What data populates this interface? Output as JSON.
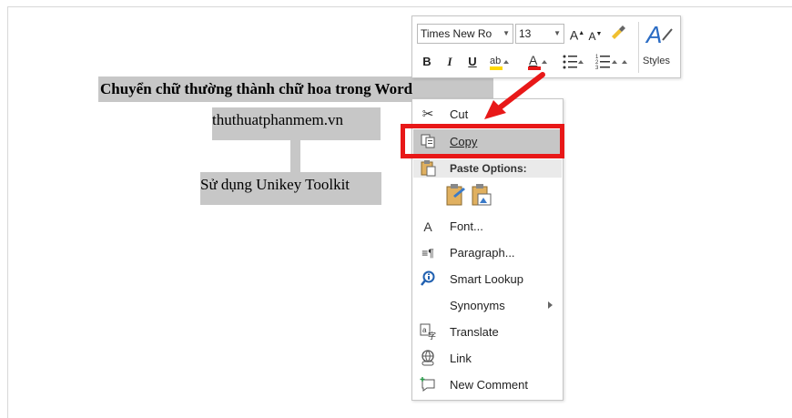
{
  "document": {
    "heading": "Chuyển chữ thường thành chữ hoa trong Word",
    "line1": "thuthuatphanmem.vn",
    "line2": "Sử dụng Unikey Toolkit"
  },
  "mini_toolbar": {
    "font_name": "Times New Ro",
    "font_size": "13",
    "bold": "B",
    "italic": "I",
    "underline": "U",
    "styles_label": "Styles",
    "font_color_hex": "#e81818",
    "highlight_hex": "#ffd800"
  },
  "context_menu": {
    "items": [
      {
        "label": "Cut",
        "icon": "scissors-icon"
      },
      {
        "label": "Copy",
        "icon": "copy-icon"
      },
      {
        "label": "Paste Options:",
        "icon": "clipboard-icon"
      },
      {
        "label": "Font...",
        "icon": "font-icon"
      },
      {
        "label": "Paragraph...",
        "icon": "paragraph-icon"
      },
      {
        "label": "Smart Lookup",
        "icon": "smart-lookup-icon"
      },
      {
        "label": "Synonyms",
        "icon": ""
      },
      {
        "label": "Translate",
        "icon": "translate-icon"
      },
      {
        "label": "Link",
        "icon": "link-icon"
      },
      {
        "label": "New Comment",
        "icon": "comment-icon"
      }
    ],
    "highlight_color": "#e81818"
  }
}
